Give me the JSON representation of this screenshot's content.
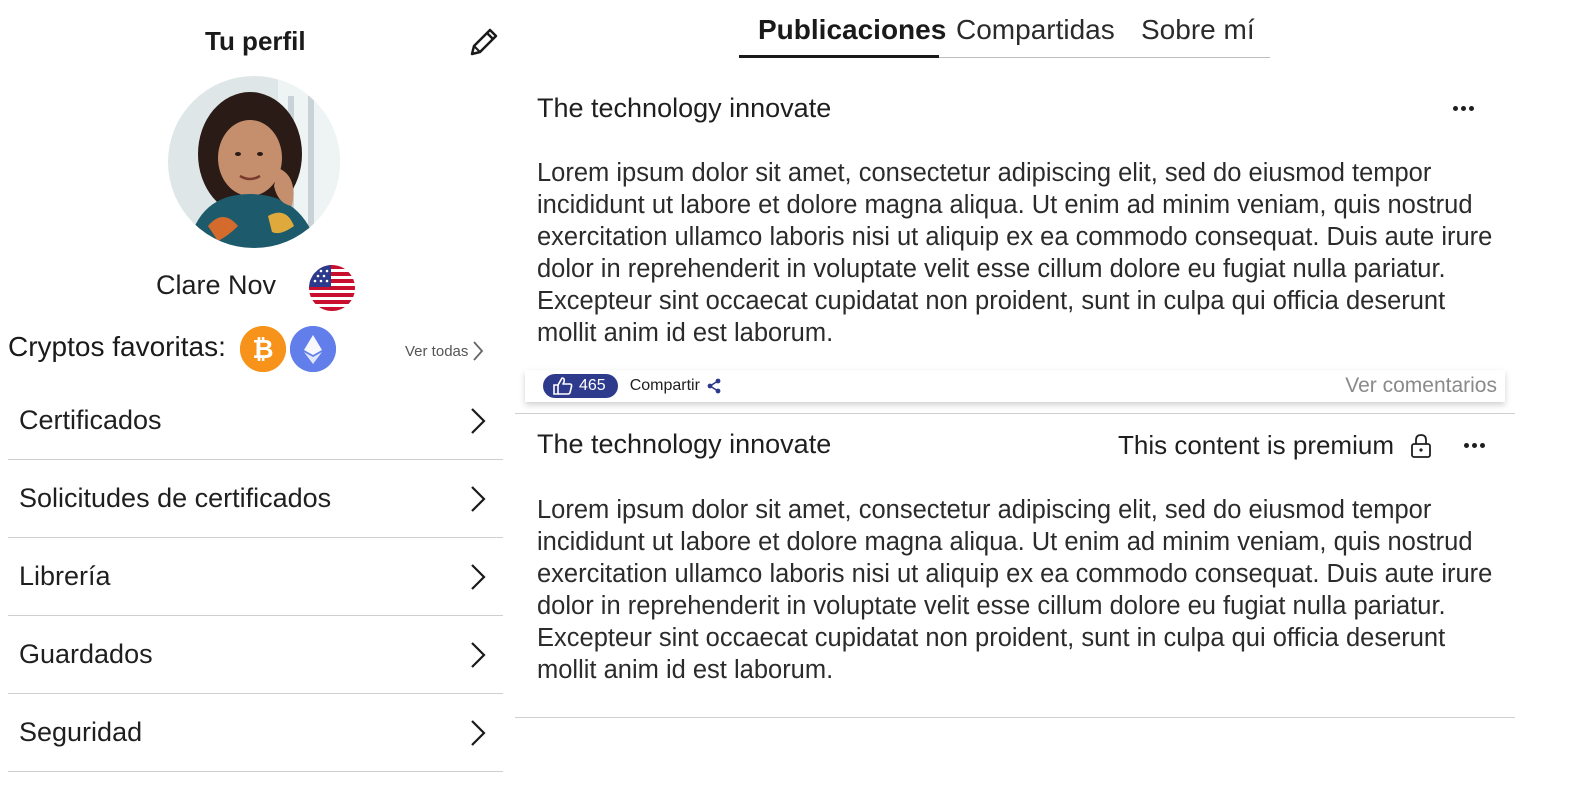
{
  "profile": {
    "title": "Tu perfil",
    "name": "Clare Nov",
    "favorites_label": "Cryptos favoritas:",
    "see_all": "Ver todas",
    "menu": [
      {
        "label": "Certificados"
      },
      {
        "label": "Solicitudes de certificados"
      },
      {
        "label": "Librería"
      },
      {
        "label": "Guardados"
      },
      {
        "label": "Seguridad"
      }
    ],
    "coins": [
      "bitcoin-icon",
      "ethereum-icon"
    ]
  },
  "tabs": [
    {
      "label": "Publicaciones",
      "active": true
    },
    {
      "label": "Compartidas",
      "active": false
    },
    {
      "label": "Sobre mí",
      "active": false
    }
  ],
  "posts": [
    {
      "title": "The technology innovate",
      "body": "Lorem ipsum dolor sit amet, consectetur adipiscing elit, sed do eiusmod tempor incididunt ut labore et dolore magna aliqua. Ut enim ad minim veniam, quis nostrud exercitation ullamco laboris nisi ut aliquip ex ea commodo consequat. Duis aute irure dolor in reprehenderit in voluptate velit esse cillum dolore eu fugiat nulla pariatur. Excepteur sint occaecat cupidatat non proident, sunt in culpa qui officia deserunt mollit anim id est laborum.",
      "likes": "465",
      "share": "Compartir",
      "comments": "Ver comentarios"
    },
    {
      "title": "The technology innovate",
      "premium": "This content is premium",
      "body": "Lorem ipsum dolor sit amet, consectetur adipiscing elit, sed do eiusmod tempor incididunt ut labore et dolore magna aliqua. Ut enim ad minim veniam, quis nostrud exercitation ullamco laboris nisi ut aliquip ex ea commodo consequat. Duis aute irure dolor in reprehenderit in voluptate velit esse cillum dolore eu fugiat nulla pariatur. Excepteur sint occaecat cupidatat non proident, sunt in culpa qui officia deserunt mollit anim id est laborum."
    }
  ],
  "colors": {
    "accent": "#2e3a8c",
    "bitcoin": "#f7931a",
    "ethereum": "#627eea"
  }
}
